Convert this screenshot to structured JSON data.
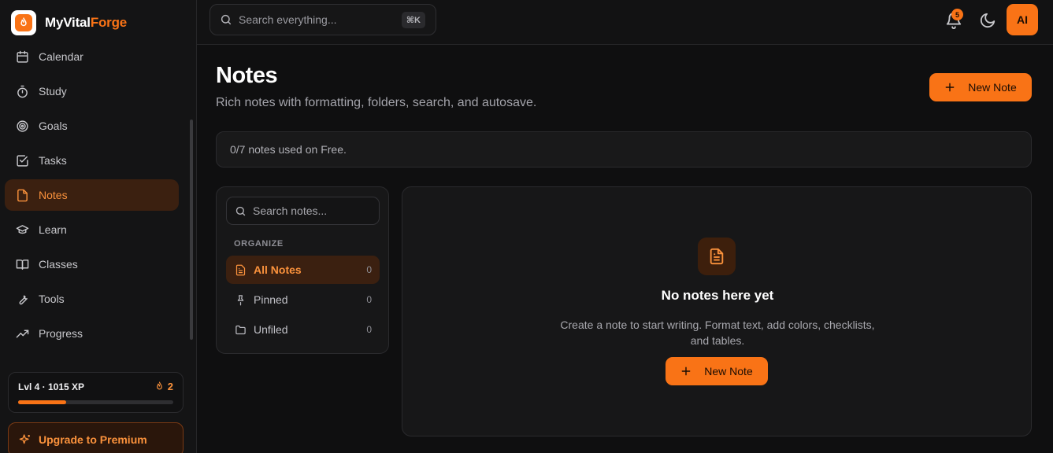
{
  "brand": {
    "name_part1": "MyVital",
    "name_part2": "Forge"
  },
  "sidebar": {
    "items": [
      {
        "label": "Calendar",
        "icon": "calendar-icon"
      },
      {
        "label": "Study",
        "icon": "timer-icon"
      },
      {
        "label": "Goals",
        "icon": "target-icon"
      },
      {
        "label": "Tasks",
        "icon": "checkbox-icon"
      },
      {
        "label": "Notes",
        "icon": "note-icon",
        "active": true
      },
      {
        "label": "Learn",
        "icon": "graduation-cap-icon"
      },
      {
        "label": "Classes",
        "icon": "book-open-icon"
      },
      {
        "label": "Tools",
        "icon": "wrench-icon"
      },
      {
        "label": "Progress",
        "icon": "trending-up-icon"
      }
    ],
    "level": {
      "label": "Lvl 4 · 1015 XP",
      "streak": "2",
      "xp_progress": 0.31
    },
    "upgrade_label": "Upgrade to Premium"
  },
  "topbar": {
    "search_placeholder": "Search everything...",
    "search_shortcut": "⌘K",
    "notification_count": "5",
    "ai_label": "AI"
  },
  "main": {
    "title": "Notes",
    "subtitle": "Rich notes with formatting, folders, search, and autosave.",
    "new_note_label": "New Note",
    "usage_text": "0/7 notes used on Free."
  },
  "folders": {
    "search_placeholder": "Search notes...",
    "section_label": "ORGANIZE",
    "items": [
      {
        "label": "All Notes",
        "count": "0",
        "icon": "document-icon",
        "active": true
      },
      {
        "label": "Pinned",
        "count": "0",
        "icon": "pin-icon"
      },
      {
        "label": "Unfiled",
        "count": "0",
        "icon": "folder-icon"
      }
    ]
  },
  "empty_state": {
    "title": "No notes here yet",
    "description": "Create a note to start writing. Format text, add colors, checklists, and tables.",
    "button_label": "New Note"
  },
  "colors": {
    "accent": "#f97316",
    "background": "#0f0f10",
    "active_bg": "#3b2010"
  }
}
